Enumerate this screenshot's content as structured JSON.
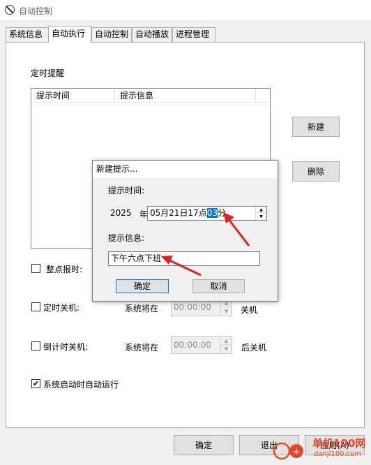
{
  "window": {
    "title": "自动控制"
  },
  "tabs": [
    {
      "label": "系统信息"
    },
    {
      "label": "自动执行"
    },
    {
      "label": "自动控制"
    },
    {
      "label": "自动播放"
    },
    {
      "label": "进程管理"
    }
  ],
  "timer": {
    "section_label": "定时提醒",
    "columns": [
      "提示时间",
      "提示信息"
    ],
    "new_button": "新建",
    "delete_button": "删除"
  },
  "options": {
    "hourly_chime": {
      "label": "整点报时:",
      "checked": false
    },
    "scheduled_shutdown": {
      "label": "定时关机:",
      "prefix": "系统将在",
      "time": "00:00:00",
      "suffix": "关机",
      "checked": false
    },
    "countdown_shutdown": {
      "label": "倒计时关机:",
      "prefix": "系统将在",
      "time": "00:00:00",
      "suffix": "后关机",
      "checked": false
    },
    "autostart": {
      "label": "系统启动时自动运行",
      "checked": true,
      "check_glyph": "✔"
    }
  },
  "footer": {
    "ok_button": "确定",
    "exit_button": "退出",
    "apply_button": "应用(A)"
  },
  "dialog": {
    "title": "新建提示...",
    "time_label": "提示时间:",
    "year": "2025",
    "year_unit": "年",
    "datetime_prefix": "05月21日17点",
    "datetime_selected": "03",
    "datetime_suffix": "分",
    "message_label": "提示信息:",
    "message_value": "下午六点下班",
    "ok_button": "确定",
    "cancel_button": "取消"
  },
  "watermark": {
    "brand": "单机100网",
    "domain": "danji100.com"
  },
  "colors": {
    "selection": "#0078d7",
    "annotation_arrow": "#e02020",
    "watermark": "#e04a2a"
  }
}
